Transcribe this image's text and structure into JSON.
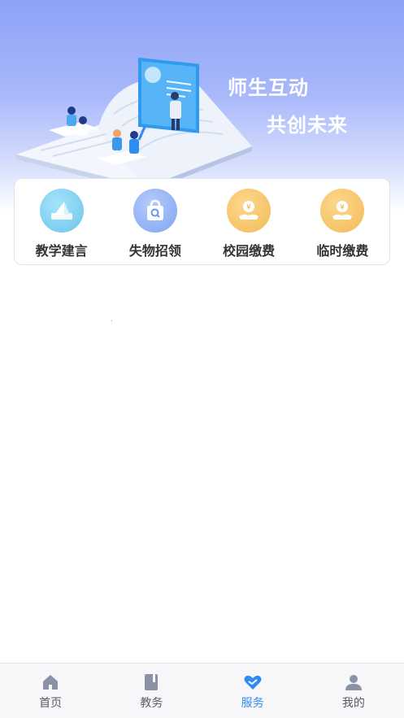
{
  "hero": {
    "title_line1": "师生互动",
    "title_line2": "共创未来"
  },
  "services": [
    {
      "label": "教学建言",
      "icon": "paper-plane-icon",
      "bg": "#7dd3f0"
    },
    {
      "label": "失物招领",
      "icon": "shopping-bag-search-icon",
      "bg": "#8fb3f7"
    },
    {
      "label": "校园缴费",
      "icon": "yuan-hand-icon",
      "bg": "#f7c86a"
    },
    {
      "label": "临时缴费",
      "icon": "yuan-hand-icon",
      "bg": "#f7c86a"
    }
  ],
  "bottom_nav": [
    {
      "label": "首页",
      "icon": "home-icon",
      "active": false
    },
    {
      "label": "教务",
      "icon": "book-icon",
      "active": false
    },
    {
      "label": "服务",
      "icon": "heart-handshake-icon",
      "active": true
    },
    {
      "label": "我的",
      "icon": "user-icon",
      "active": false
    }
  ],
  "colors": {
    "accent": "#2f8cf5",
    "hero_top": "#8ea2f7",
    "nav_bg": "#f7f7f9"
  }
}
